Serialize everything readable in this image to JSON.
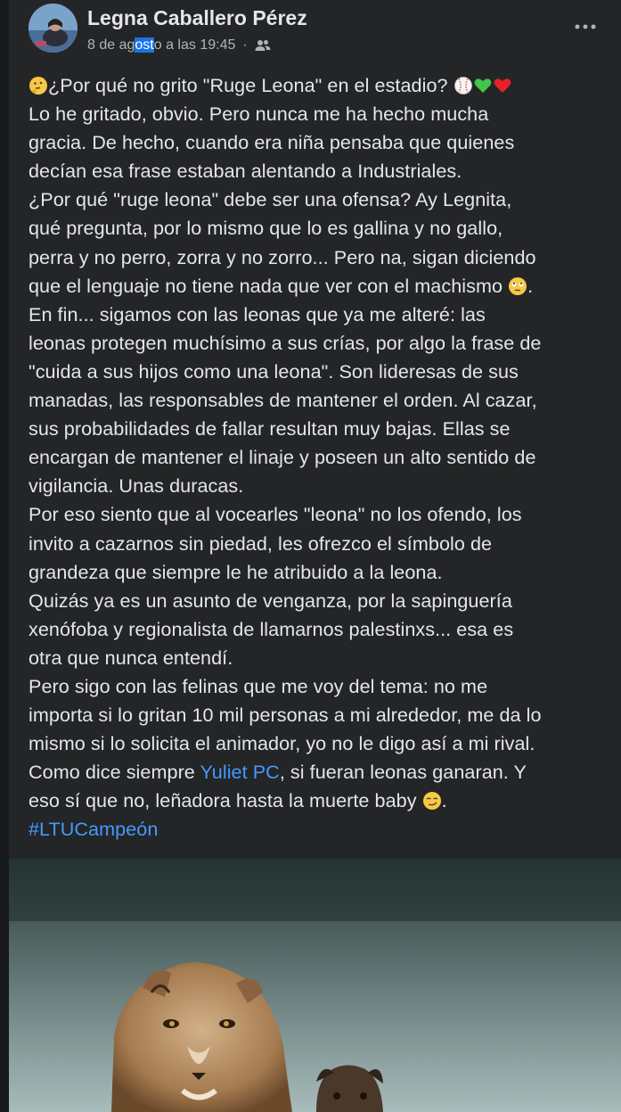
{
  "post": {
    "author": "Legna Caballero Pérez",
    "date_pre": "8 de ag",
    "date_sel": "ost",
    "date_post": "o a las 19:45",
    "separator": "·",
    "audience_icon": "friends-icon",
    "more_icon": "more-options-icon",
    "avatar_icon": "profile-photo"
  },
  "content": {
    "l1": "¿Por qué no grito \"Ruge Leona\" en el estadio?",
    "l2": "Lo he gritado, obvio. Pero nunca me ha hecho mucha",
    "l3": "gracia. De hecho, cuando era niña pensaba que quienes",
    "l4": "decían esa frase estaban alentando a Industriales.",
    "l5": "¿Por qué \"ruge leona\" debe ser una ofensa? Ay Legnita,",
    "l6": "qué pregunta, por lo mismo que lo es gallina y no gallo,",
    "l7": "perra y no perro, zorra y no zorro... Pero na, sigan diciendo",
    "l8": "que el lenguaje no tiene nada que ver con el machismo",
    "l9": "En fin... sigamos con las leonas que ya me alteré: las",
    "l10": "leonas protegen muchísimo a sus crías, por algo la frase de",
    "l11": "\"cuida a sus hijos como una leona\". Son lideresas de sus",
    "l12": "manadas, las responsables de mantener el orden. Al cazar,",
    "l13": "sus probabilidades de fallar resultan muy bajas. Ellas se",
    "l14": "encargan de mantener el linaje y poseen un alto sentido de",
    "l15": "vigilancia. Unas duracas.",
    "l16": "Por eso siento que al vocearles \"leona\" no los ofendo, los",
    "l17": "invito a cazarnos sin piedad, les ofrezco el símbolo de",
    "l18": "grandeza que siempre le he atribuido a la leona.",
    "l19": "Quizás ya es un asunto de venganza, por la sapinguería",
    "l20": "xenófoba y regionalista de llamarnos palestinxs... esa es",
    "l21": "otra que nunca entendí.",
    "l22": "Pero sigo con las felinas que me voy del tema: no me",
    "l23": "importa si lo gritan 10 mil personas a mi alrededor, me da lo",
    "l24": "mismo si lo solicita el animador, yo no le digo así a mi rival.",
    "l25a": "Como dice siempre ",
    "mention": "Yuliet PC",
    "l25b": ", si fueran leonas ganaran. Y",
    "l26": "eso sí que no, leñadora hasta la muerte baby",
    "l26end": ".",
    "l8end": ".",
    "hashtag": "#LTUCampeón"
  },
  "emoji": {
    "thinking": "thinking-face-icon",
    "baseball": "baseball-icon",
    "green_heart": "green-heart-icon",
    "red_heart": "red-heart-icon",
    "eye_roll": "face-with-rolling-eyes-icon",
    "smirk": "smirking-face-icon"
  },
  "image": {
    "subject": "lioness-with-cub-photo"
  },
  "colors": {
    "background": "#242526",
    "text": "#e4e6eb",
    "secondary": "#b0b3b8",
    "link": "#4599ff",
    "selection": "#1a73e8"
  }
}
